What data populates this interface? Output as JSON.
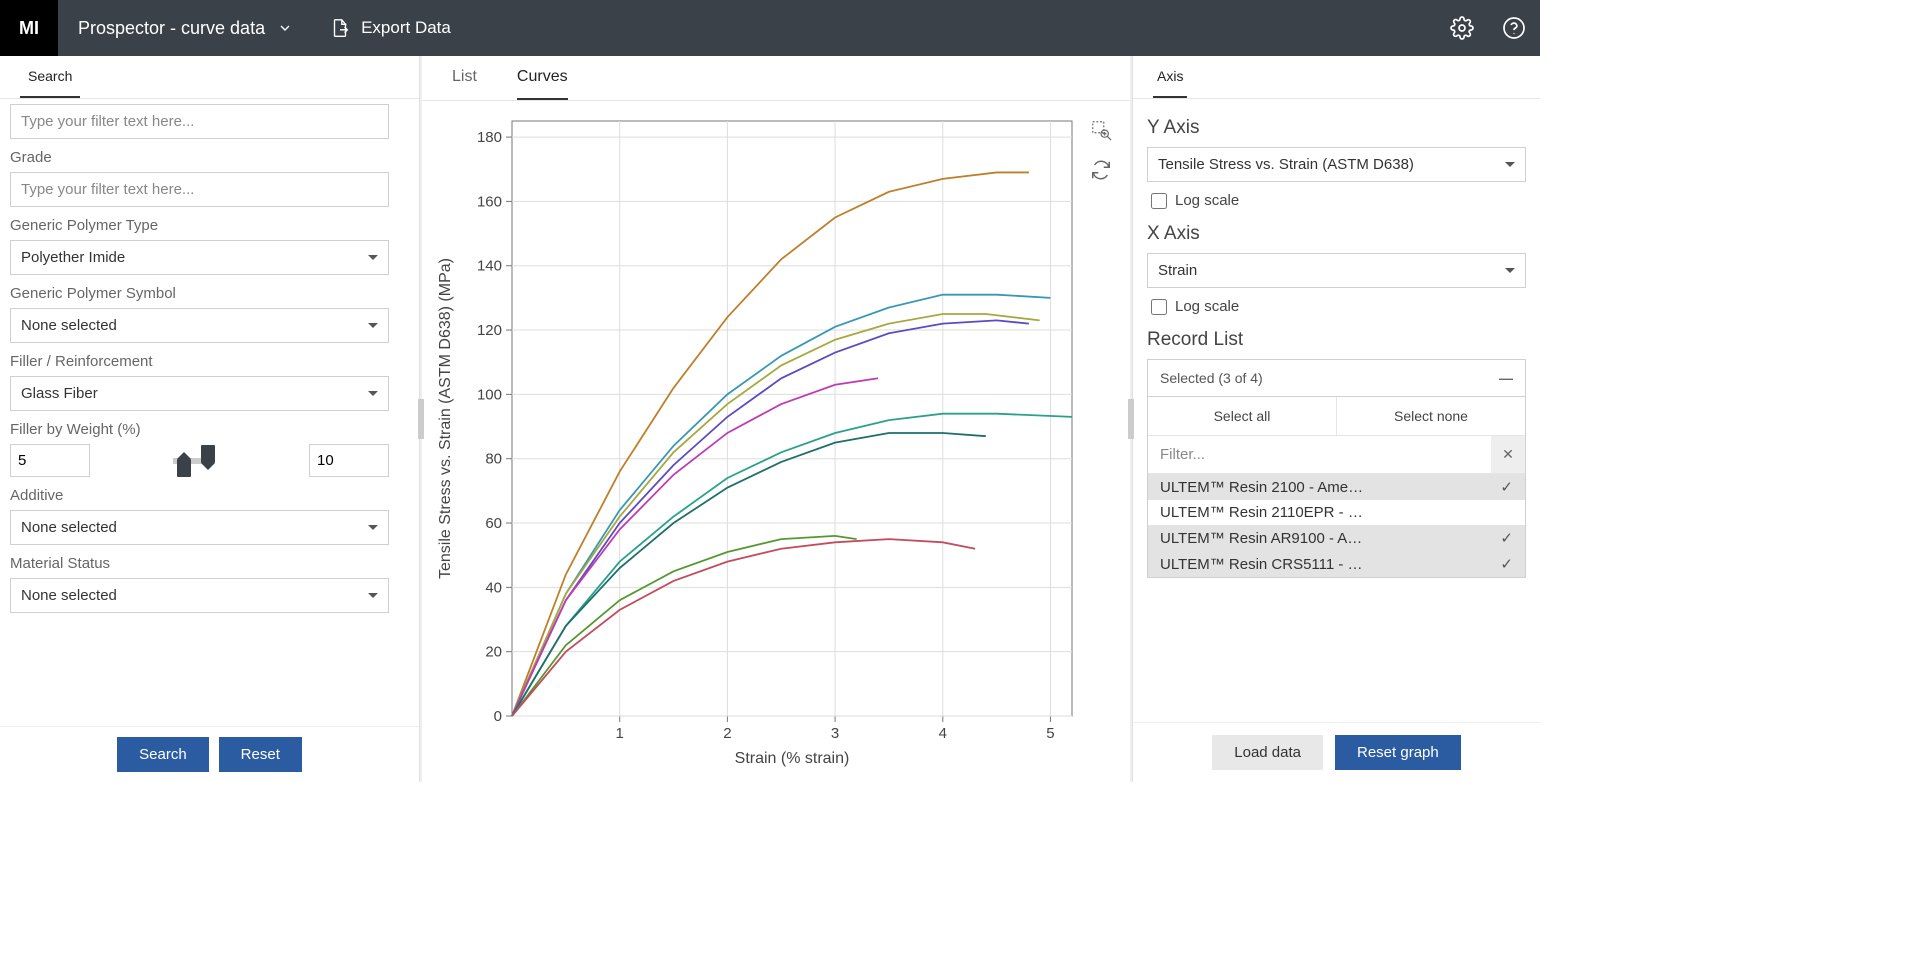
{
  "header": {
    "logo": "MI",
    "title": "Prospector - curve data",
    "export_label": "Export Data"
  },
  "sidebar": {
    "tab_search": "Search",
    "filter1_placeholder": "Type your filter text here...",
    "grade_label": "Grade",
    "grade_placeholder": "Type your filter text here...",
    "polytype_label": "Generic Polymer Type",
    "polytype_value": "Polyether Imide",
    "polysym_label": "Generic Polymer Symbol",
    "polysym_value": "None selected",
    "filler_label": "Filler / Reinforcement",
    "filler_value": "Glass Fiber",
    "fillerwt_label": "Filler by Weight (%)",
    "fillerwt_min": "5",
    "fillerwt_max": "10",
    "additive_label": "Additive",
    "additive_value": "None selected",
    "matstatus_label": "Material Status",
    "matstatus_value": "None selected",
    "search_btn": "Search",
    "reset_btn": "Reset"
  },
  "data_tabs": {
    "list": "List",
    "curves": "Curves"
  },
  "right": {
    "tab_axis": "Axis",
    "yaxis_title": "Y Axis",
    "yaxis_value": "Tensile Stress vs. Strain (ASTM D638)",
    "xaxis_title": "X Axis",
    "xaxis_value": "Strain",
    "log_label": "Log scale",
    "recordlist_title": "Record List",
    "selected_text": "Selected (3 of 4)",
    "select_all": "Select all",
    "select_none": "Select none",
    "filter_placeholder": "Filter...",
    "records": [
      {
        "name": "ULTEM™ Resin 2100 - Ame…",
        "selected": true
      },
      {
        "name": "ULTEM™ Resin 2110EPR - …",
        "selected": false
      },
      {
        "name": "ULTEM™ Resin AR9100 - A…",
        "selected": true
      },
      {
        "name": "ULTEM™ Resin CRS5111 - …",
        "selected": true
      }
    ],
    "load_btn": "Load data",
    "reset_btn": "Reset graph"
  },
  "chart_data": {
    "type": "line",
    "ylabel": "Tensile Stress vs. Strain (ASTM D638) (MPa)",
    "xlabel": "Strain (% strain)",
    "xlim": [
      0,
      5.2
    ],
    "ylim": [
      0,
      185
    ],
    "xticks": [
      1,
      2,
      3,
      4,
      5
    ],
    "yticks": [
      0,
      20,
      40,
      60,
      80,
      100,
      120,
      140,
      160,
      180
    ],
    "series": [
      {
        "name": "s1",
        "color": "#be7f2a",
        "x": [
          0,
          0.5,
          1,
          1.5,
          2,
          2.5,
          3,
          3.5,
          4,
          4.5,
          4.8
        ],
        "y": [
          0,
          44,
          76,
          102,
          124,
          142,
          155,
          163,
          167,
          169,
          169
        ]
      },
      {
        "name": "s2",
        "color": "#3698b5",
        "x": [
          0,
          0.5,
          1,
          1.5,
          2,
          2.5,
          3,
          3.5,
          4,
          4.5,
          5
        ],
        "y": [
          0,
          38,
          64,
          84,
          100,
          112,
          121,
          127,
          131,
          131,
          130
        ]
      },
      {
        "name": "s3",
        "color": "#a8a83e",
        "x": [
          0,
          0.5,
          1,
          1.5,
          2,
          2.5,
          3,
          3.5,
          4,
          4.4,
          4.9
        ],
        "y": [
          0,
          38,
          62,
          82,
          97,
          109,
          117,
          122,
          125,
          125,
          123
        ]
      },
      {
        "name": "s4",
        "color": "#5d49c3",
        "x": [
          0,
          0.5,
          1,
          1.5,
          2,
          2.5,
          3,
          3.5,
          4,
          4.5,
          4.8
        ],
        "y": [
          0,
          36,
          60,
          78,
          93,
          105,
          113,
          119,
          122,
          123,
          122
        ]
      },
      {
        "name": "s5",
        "color": "#c03bb3",
        "x": [
          0,
          0.5,
          1,
          1.5,
          2,
          2.5,
          3,
          3.4
        ],
        "y": [
          0,
          36,
          58,
          75,
          88,
          97,
          103,
          105
        ]
      },
      {
        "name": "s6",
        "color": "#2aa18a",
        "x": [
          0,
          0.5,
          1,
          1.5,
          2,
          2.5,
          3,
          3.5,
          4,
          4.5,
          5.2
        ],
        "y": [
          0,
          28,
          48,
          62,
          74,
          82,
          88,
          92,
          94,
          94,
          93
        ]
      },
      {
        "name": "s7",
        "color": "#1f6d6d",
        "x": [
          0,
          0.5,
          1,
          1.5,
          2,
          2.5,
          3,
          3.5,
          4,
          4.4
        ],
        "y": [
          0,
          28,
          46,
          60,
          71,
          79,
          85,
          88,
          88,
          87
        ]
      },
      {
        "name": "s8",
        "color": "#54992f",
        "x": [
          0,
          0.5,
          1,
          1.5,
          2,
          2.5,
          3,
          3.2
        ],
        "y": [
          0,
          22,
          36,
          45,
          51,
          55,
          56,
          55
        ]
      },
      {
        "name": "s9",
        "color": "#c44a5e",
        "x": [
          0,
          0.5,
          1,
          1.5,
          2,
          2.5,
          3,
          3.5,
          4,
          4.3
        ],
        "y": [
          0,
          20,
          33,
          42,
          48,
          52,
          54,
          55,
          54,
          52
        ]
      }
    ]
  }
}
